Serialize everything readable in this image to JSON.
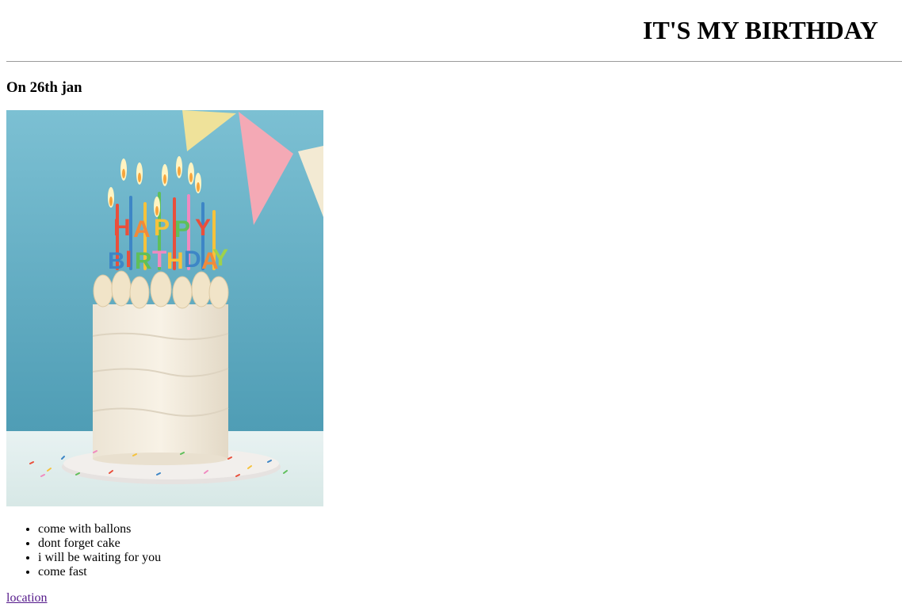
{
  "header": {
    "title": "IT'S MY BIRTHDAY",
    "subtitle": "On 26th jan"
  },
  "image": {
    "description_icon": "birthday-cake-photo",
    "candle_letters": "HAPPY BIRTHDAY"
  },
  "list": {
    "items": [
      "come with ballons",
      "dont forget cake",
      "i will be waiting for you",
      "come fast"
    ]
  },
  "footer": {
    "link_label": "location"
  },
  "colors": {
    "background": "#ffffff",
    "text": "#000000",
    "visited_link": "#551a8b",
    "rule": "#9a9a9a",
    "photo_wall": "#5fb0c8"
  }
}
